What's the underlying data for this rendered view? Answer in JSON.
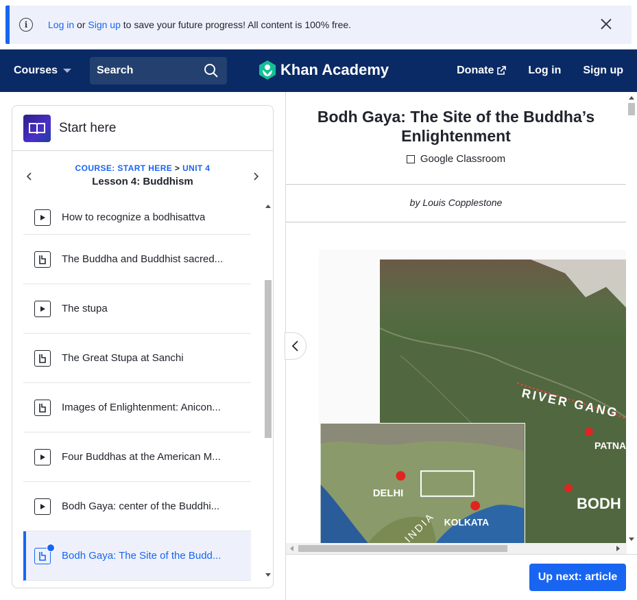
{
  "banner": {
    "login": "Log in",
    "or": "or",
    "signup": "Sign up",
    "rest": "to save your future progress! All content is 100% free."
  },
  "header": {
    "courses": "Courses",
    "search_placeholder": "Search",
    "brand": "Khan Academy",
    "donate": "Donate",
    "login": "Log in",
    "signup": "Sign up"
  },
  "sidebar": {
    "title": "Start here",
    "course": "COURSE: START HERE",
    "sep": ">",
    "unit": "UNIT 4",
    "lesson": "Lesson 4: Buddhism",
    "items": [
      {
        "type": "video",
        "label": "How to recognize a bodhisattva"
      },
      {
        "type": "article",
        "label": "The Buddha and Buddhist sacred..."
      },
      {
        "type": "video",
        "label": "The stupa"
      },
      {
        "type": "article",
        "label": "The Great Stupa at Sanchi"
      },
      {
        "type": "article",
        "label": "Images of Enlightenment: Anicon..."
      },
      {
        "type": "video",
        "label": "Four Buddhas at the American M..."
      },
      {
        "type": "video",
        "label": "Bodh Gaya: center of the Buddhi..."
      },
      {
        "type": "article",
        "label": "Bodh Gaya: The Site of the Budd...",
        "active": true
      }
    ]
  },
  "article": {
    "title": "Bodh Gaya: The Site of the Buddha’s Enlightenment",
    "google_classroom": "Google Classroom",
    "byline": "by Louis Copplestone",
    "map_labels": {
      "river": "RIVER GANG",
      "patna": "PATNA",
      "bodh": "BODH",
      "delhi": "DELHI",
      "kolkata": "KOLKATA",
      "india": "INDIA"
    }
  },
  "footer": {
    "up_next": "Up next: article"
  },
  "colors": {
    "accent": "#1865f2",
    "header_bg": "#0a2a66",
    "banner_bg": "#eef1fb",
    "brand_green": "#14bf96"
  }
}
